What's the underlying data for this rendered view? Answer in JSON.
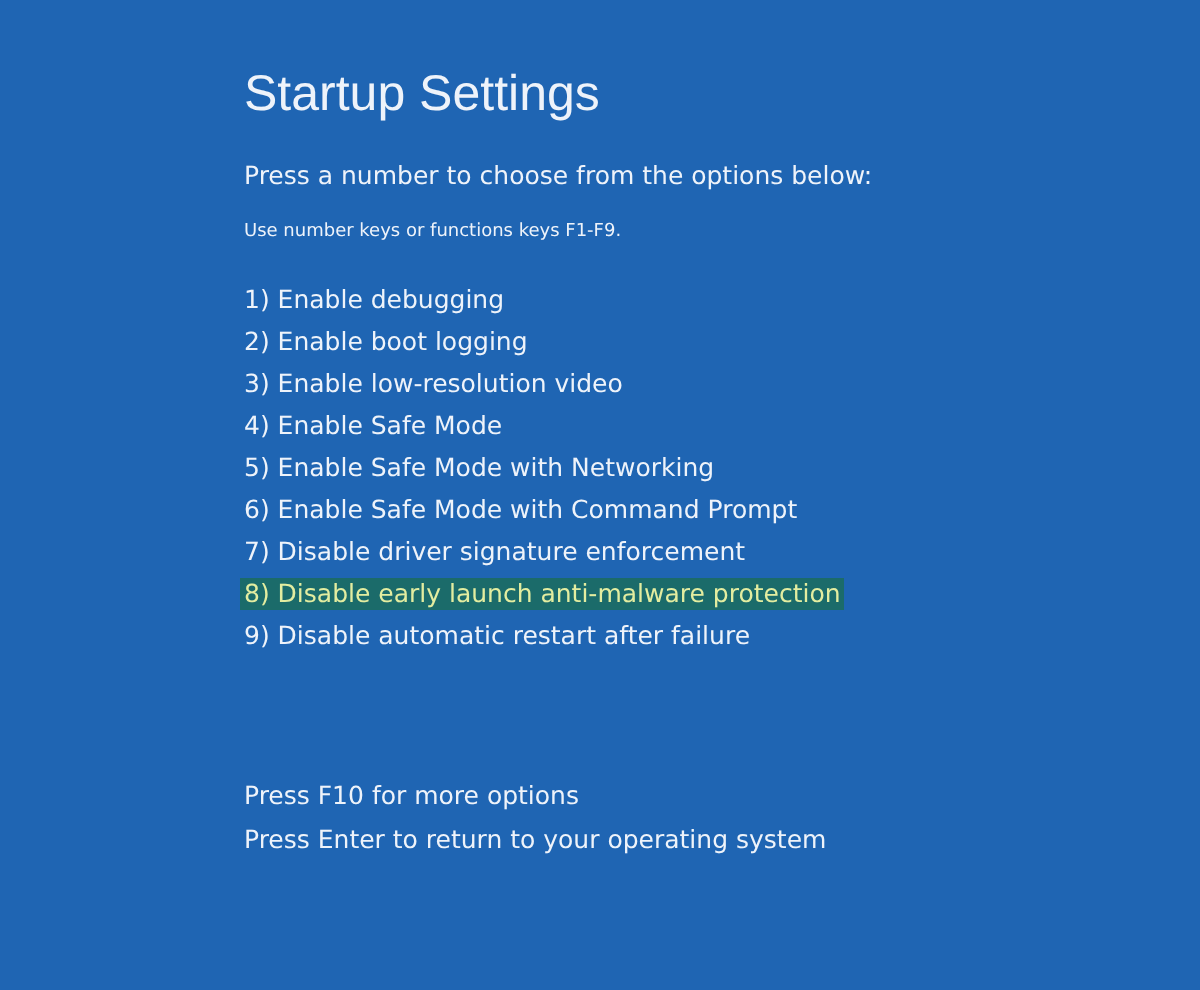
{
  "title": "Startup Settings",
  "prompt": "Press a number to choose from the options below:",
  "hint": "Use number keys or functions keys F1-F9.",
  "options": [
    {
      "label": "1) Enable debugging",
      "selected": false
    },
    {
      "label": "2) Enable boot logging",
      "selected": false
    },
    {
      "label": "3) Enable low-resolution video",
      "selected": false
    },
    {
      "label": "4) Enable Safe Mode",
      "selected": false
    },
    {
      "label": "5) Enable Safe Mode with Networking",
      "selected": false
    },
    {
      "label": "6) Enable Safe Mode with Command Prompt",
      "selected": false
    },
    {
      "label": "7) Disable driver signature enforcement",
      "selected": false
    },
    {
      "label": "8) Disable early launch anti-malware protection",
      "selected": true
    },
    {
      "label": "9) Disable automatic restart after failure",
      "selected": false
    }
  ],
  "footer": [
    "Press F10 for more options",
    "Press Enter to return to your operating system"
  ]
}
